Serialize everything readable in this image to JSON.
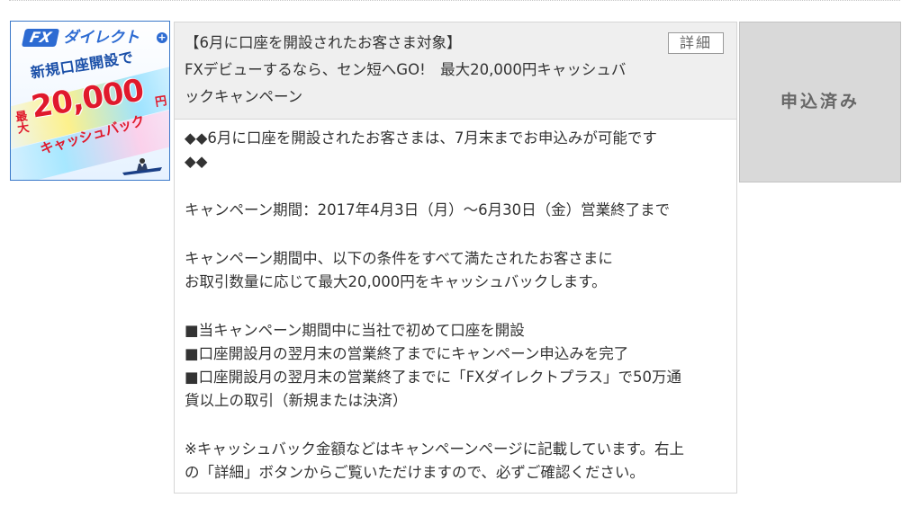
{
  "banner": {
    "logo_fx": "FX",
    "logo_text": "ダイレクト",
    "logo_plus": "+",
    "headline": "新規口座開設で",
    "max_label": "最大",
    "amount": "20,000",
    "yen": "円",
    "cashback": "キャッシュバック"
  },
  "campaign": {
    "title_line1": "【6月に口座を開設されたお客さま対象】",
    "title_line2": "FXデビューするなら、セン短へGO!　最大20,000円キャッシュバ",
    "title_line3": "ックキャンペーン",
    "detail_button": "詳細",
    "body": [
      "◆◆6月に口座を開設されたお客さまは、7月末までお申込みが可能です",
      "◆◆",
      "キャンペーン期間：2017年4月3日（月）〜6月30日（金）営業終了まで",
      "キャンペーン期間中、以下の条件をすべて満たされたお客さまに",
      "お取引数量に応じて最大20,000円をキャッシュバックします。",
      "■当キャンペーン期間中に当社で初めて口座を開設",
      "■口座開設月の翌月末の営業終了までにキャンペーン申込みを完了",
      "■口座開設月の翌月末の営業終了までに「FXダイレクトプラス」で50万通",
      "貨以上の取引（新規または決済）",
      "※キャッシュバック金額などはキャンペーンページに記載しています。右上",
      "の「詳細」ボタンからご覧いただけますので、必ずご確認ください。"
    ]
  },
  "applied_button": "申込済み",
  "colors": {
    "brand_blue": "#2d6bd2",
    "accent_red": "#e0192c",
    "panel_header_bg": "#efefef",
    "applied_bg": "#d9d9d9"
  }
}
